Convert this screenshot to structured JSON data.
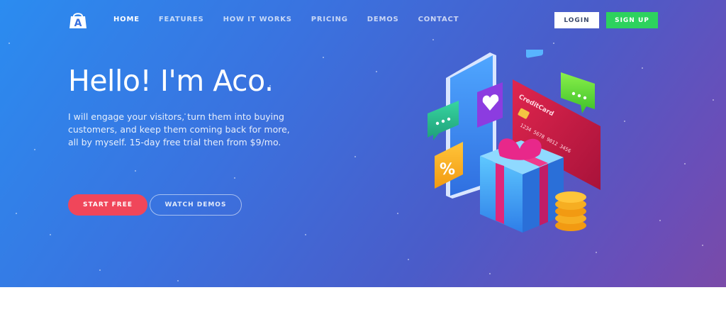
{
  "brand": {
    "logo_letter": "A",
    "logo_icon": "shopping-bag-icon"
  },
  "nav": {
    "items": [
      {
        "label": "HOME",
        "active": true
      },
      {
        "label": "FEATURES",
        "active": false
      },
      {
        "label": "HOW IT WORKS",
        "active": false
      },
      {
        "label": "PRICING",
        "active": false
      },
      {
        "label": "DEMOS",
        "active": false
      },
      {
        "label": "CONTACT",
        "active": false
      }
    ],
    "login_label": "LOGIN",
    "signup_label": "SIGN UP"
  },
  "hero": {
    "headline": "Hello! I'm Aco.",
    "subtext": "I will engage your visitors, turn them into buying customers, and keep them coming back for more, all by myself. 15-day free trial then from $9/mo.",
    "start_label": "START FREE",
    "demos_label": "WATCH DEMOS"
  },
  "illustration": {
    "card_label": "CreditCard",
    "card_number": "1234 5678 9012 3456",
    "percent_symbol": "%"
  },
  "colors": {
    "gradient_start": "#2b8cf0",
    "gradient_end": "#7a4aa8",
    "signup_green": "#2dd25e",
    "start_red": "#f0465a"
  }
}
